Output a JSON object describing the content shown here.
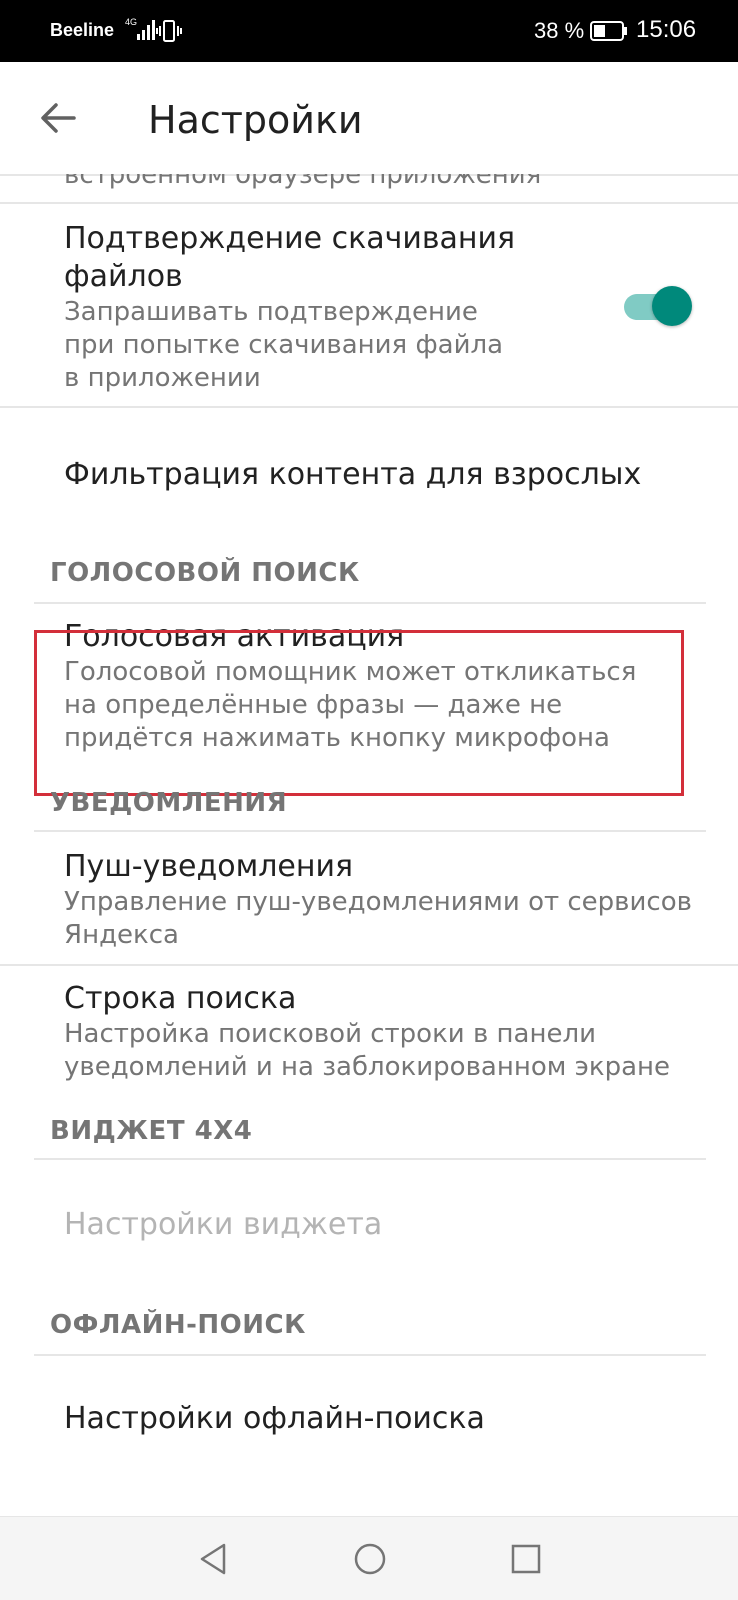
{
  "status_bar": {
    "carrier": "Beeline",
    "network": "4G",
    "battery": "38 %",
    "time": "15:06"
  },
  "app_bar": {
    "title": "Настройки",
    "back_icon": "arrow-back-icon"
  },
  "settings": {
    "clipped_text": "встроенном браузере приложения",
    "download_confirm": {
      "title": "Подтверждение скачивания",
      "title_line2": "файлов",
      "subtitle": "Запрашивать подтверждение при попытке скачивания файла в приложении",
      "toggle": "on"
    },
    "adult_filter": {
      "title": "Фильтрация контента для взрослых"
    },
    "voice_section": "ГОЛОСОВОЙ ПОИСК",
    "voice_activation": {
      "title": "Голосовая активация",
      "subtitle": "Голосовой помощник может откликаться на определённые фразы — даже не придётся нажимать кнопку микрофона"
    },
    "notifications_section": "УВЕДОМЛЕНИЯ",
    "push": {
      "title": "Пуш-уведомления",
      "subtitle": "Управление пуш-уведомлениями от сервисов Яндекса"
    },
    "search_bar": {
      "title": "Строка поиска",
      "subtitle": "Настройка поисковой строки в панели уведомлений и на заблокированном экране"
    },
    "widget_section": "ВИДЖЕТ 4X4",
    "widget_settings": {
      "title": "Настройки виджета"
    },
    "offline_section": "ОФЛАЙН-ПОИСК",
    "offline_settings": {
      "title": "Настройки офлайн-поиска"
    }
  },
  "colors": {
    "accent": "#00897b",
    "accent_light": "#80cbc4",
    "highlight_border": "#d32f3a",
    "text_primary": "#212121",
    "text_secondary": "#757575"
  }
}
